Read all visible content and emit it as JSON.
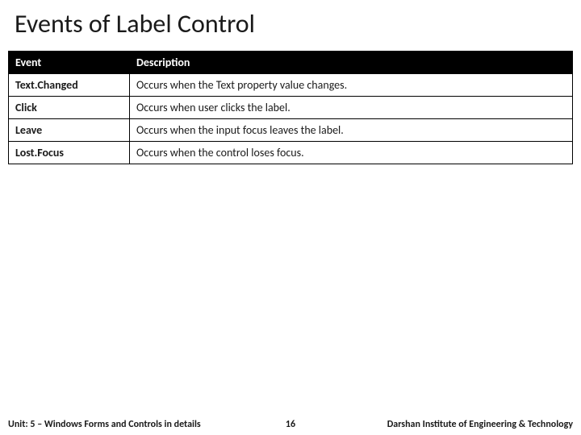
{
  "title": "Events of Label Control",
  "table": {
    "headers": {
      "event": "Event",
      "description": "Description"
    },
    "rows": [
      {
        "event": "Text.Changed",
        "description": "Occurs when the Text property value changes."
      },
      {
        "event": "Click",
        "description": "Occurs when user clicks the label."
      },
      {
        "event": "Leave",
        "description": "Occurs when the input focus leaves the label."
      },
      {
        "event": "Lost.Focus",
        "description": "Occurs when the control loses focus."
      }
    ]
  },
  "footer": {
    "unit": "Unit: 5 – Windows Forms and Controls in details",
    "page": "16",
    "institute": "Darshan Institute of Engineering & Technology"
  }
}
